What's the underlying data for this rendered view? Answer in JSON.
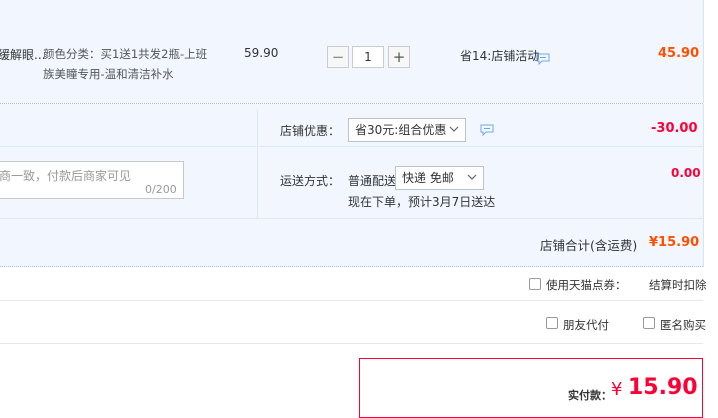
{
  "item": {
    "title_fragment": "缓解眼...",
    "spec_line1": "颜色分类：买1送1共发2瓶-上班",
    "spec_line2": "族美瞳专用-温和清洁补水",
    "unit_price": "59.90",
    "quantity": "1",
    "minus_label": "−",
    "plus_label": "+",
    "promo_text": "省14:店铺活动",
    "subtotal": "45.90"
  },
  "shop_discount": {
    "label": "店铺优惠：",
    "selected": "省30元:组合优惠",
    "amount": "-30.00"
  },
  "message": {
    "placeholder_fragment": "商一致，付款后商家可见",
    "counter": "0/200"
  },
  "shipping": {
    "label": "运送方式：",
    "method_prefix": "普通配送",
    "selected": "快递 免邮",
    "amount": "0.00",
    "eta": "现在下单，预计3月7日送达"
  },
  "shop_total": {
    "label": "店铺合计(含运费)",
    "value": "¥15.90"
  },
  "tmall_points": {
    "label": "使用天猫点券：",
    "note": "结算时扣除"
  },
  "options": {
    "friend_pay": "朋友代付",
    "anonymous": "匿名购买"
  },
  "payment": {
    "label": "实付款：",
    "currency": "¥",
    "amount": "15.90"
  },
  "colors": {
    "accent_red": "#ff0036",
    "accent_orange": "#ff5000",
    "row_bg": "#f2f7ff"
  },
  "icons": [
    "minus-icon",
    "plus-icon",
    "chat-icon",
    "chevron-down-icon",
    "checkbox-icon"
  ]
}
